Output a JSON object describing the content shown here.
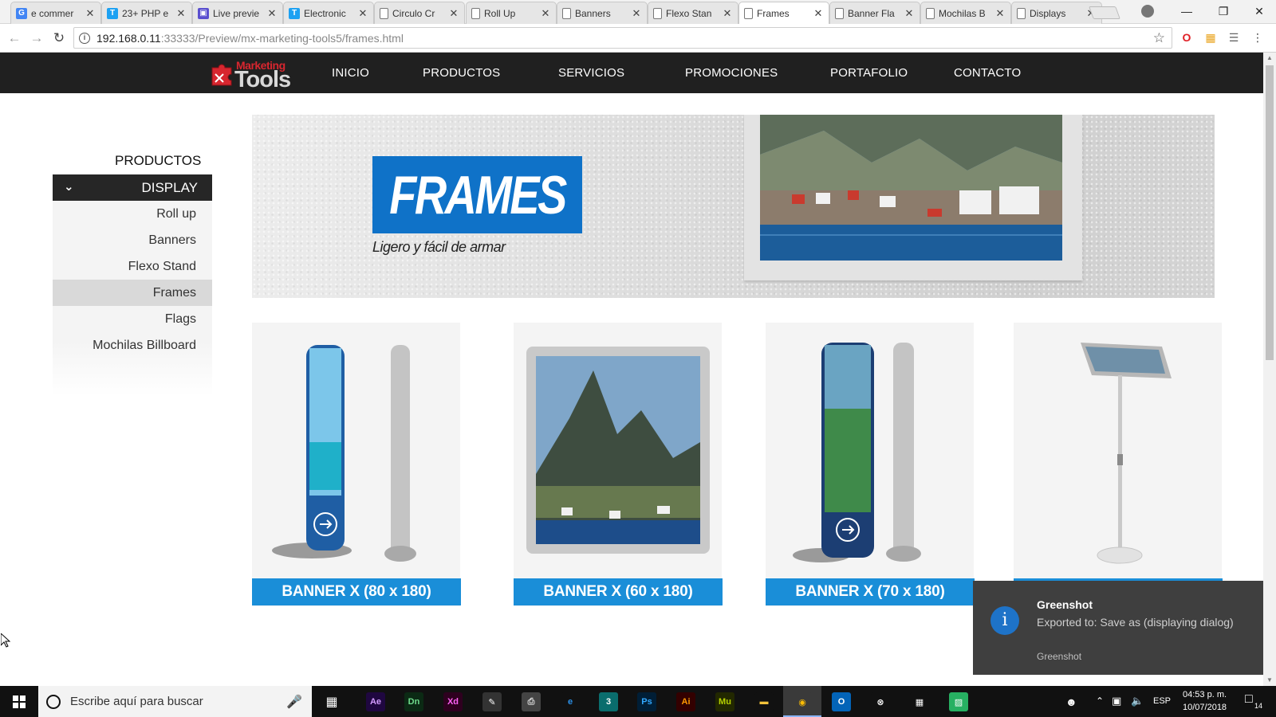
{
  "browser": {
    "tabs": [
      {
        "title": "e commer",
        "icon": "google-icon",
        "color": "#4285f4"
      },
      {
        "title": "23+ PHP e",
        "icon": "t-icon",
        "color": "#1da1f2"
      },
      {
        "title": "Live previe",
        "icon": "preview-icon",
        "color": "#5a4fcf"
      },
      {
        "title": "Electronic",
        "icon": "t-icon",
        "color": "#1da1f2"
      },
      {
        "title": "Circulo Cr",
        "icon": "page-icon",
        "color": ""
      },
      {
        "title": "Roll Up",
        "icon": "page-icon",
        "color": ""
      },
      {
        "title": "Banners",
        "icon": "page-icon",
        "color": ""
      },
      {
        "title": "Flexo Stan",
        "icon": "page-icon",
        "color": ""
      },
      {
        "title": "Frames",
        "icon": "page-icon",
        "color": "",
        "active": true
      },
      {
        "title": "Banner Fla",
        "icon": "page-icon",
        "color": ""
      },
      {
        "title": "Mochilas B",
        "icon": "page-icon",
        "color": ""
      },
      {
        "title": "Displays",
        "icon": "page-icon",
        "color": ""
      }
    ],
    "url_host": "192.168.0.11",
    "url_path": ":33333/Preview/mx-marketing-tools5/frames.html"
  },
  "site": {
    "logo_top": "Marketing",
    "logo_bottom": "Tools",
    "menu": [
      "INICIO",
      "PRODUCTOS",
      "SERVICIOS",
      "PROMOCIONES",
      "PORTAFOLIO",
      "CONTACTO"
    ]
  },
  "sidebar": {
    "title": "PRODUCTOS",
    "category": "DISPLAY",
    "items": [
      "Roll up",
      "Banners",
      "Flexo Stand",
      "Frames",
      "Flags",
      "Mochilas Billboard"
    ],
    "active_index": 3
  },
  "hero": {
    "title": "FRAMES",
    "subtitle": "Ligero y fácil de armar"
  },
  "products": [
    {
      "label": "BANNER X (80 x 180)"
    },
    {
      "label": "BANNER X (60 x 180)"
    },
    {
      "label": "BANNER X (70 x 180)"
    },
    {
      "label": ""
    }
  ],
  "toast": {
    "title": "Greenshot",
    "message": "Exported to: Save as (displaying dialog)",
    "app": "Greenshot"
  },
  "taskbar": {
    "search_placeholder": "Escribe aquí para buscar",
    "apps": [
      {
        "icon": "ae-icon",
        "text": "Ae",
        "bg": "#1f0740",
        "fg": "#d39bff"
      },
      {
        "icon": "dn-icon",
        "text": "Dn",
        "bg": "#0b2a14",
        "fg": "#6fdc8c"
      },
      {
        "icon": "xd-icon",
        "text": "Xd",
        "bg": "#2e001f",
        "fg": "#ff61f6"
      },
      {
        "icon": "inkscape-icon",
        "text": "✎",
        "bg": "#333",
        "fg": "#fff"
      },
      {
        "icon": "printer-icon",
        "text": "⎙",
        "bg": "#444",
        "fg": "#ddd"
      },
      {
        "icon": "edge-icon",
        "text": "e",
        "bg": "#111",
        "fg": "#2b90e8"
      },
      {
        "icon": "3dsmax-icon",
        "text": "3",
        "bg": "#0a6d6d",
        "fg": "#fff"
      },
      {
        "icon": "ps-icon",
        "text": "Ps",
        "bg": "#001e36",
        "fg": "#31a8ff"
      },
      {
        "icon": "ai-icon",
        "text": "Ai",
        "bg": "#330000",
        "fg": "#ff9a00"
      },
      {
        "icon": "mu-icon",
        "text": "Mu",
        "bg": "#222800",
        "fg": "#b6d100"
      },
      {
        "icon": "folder-icon",
        "text": "▬",
        "bg": "#111",
        "fg": "#f3c33b"
      },
      {
        "icon": "chrome-icon",
        "text": "◉",
        "bg": "#3a3a3a",
        "fg": "#fbbc04"
      },
      {
        "icon": "outlook-icon",
        "text": "O",
        "bg": "#0364b8",
        "fg": "#fff"
      },
      {
        "icon": "xbox-icon",
        "text": "⊗",
        "bg": "#111",
        "fg": "#fff"
      },
      {
        "icon": "store-icon",
        "text": "▦",
        "bg": "#111",
        "fg": "#fff"
      },
      {
        "icon": "sourcetree-icon",
        "text": "▨",
        "bg": "#27b062",
        "fg": "#fff"
      }
    ],
    "lang": "ESP",
    "time": "04:53 p. m.",
    "date": "10/07/2018",
    "notif_count": "14"
  }
}
